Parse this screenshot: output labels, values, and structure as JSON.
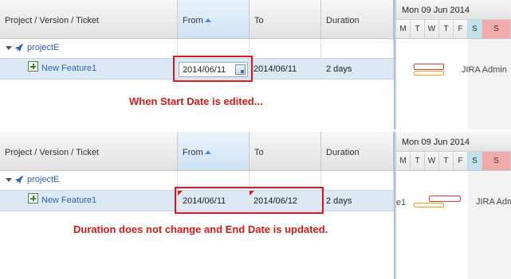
{
  "columns": {
    "project": "Project / Version / Ticket",
    "from": "From",
    "to": "To",
    "duration": "Duration"
  },
  "project_row": {
    "name": "projectE"
  },
  "before": {
    "ticket": "New Feature1",
    "from_value": "2014/06/11",
    "to_value": "2014/06/11",
    "duration_value": "2 days",
    "caption": "When Start Date is edited..."
  },
  "after": {
    "ticket": "New Feature1",
    "ticket_clipped": "e1",
    "from_value": "2014/06/11",
    "to_value": "2014/06/12",
    "duration_value": "2 days",
    "caption": "Duration does not change and End Date is updated."
  },
  "gantt": {
    "week_label": "Mon 09 Jun 2014",
    "days": [
      "M",
      "T",
      "W",
      "T",
      "F",
      "S",
      "S"
    ],
    "assignee": "JIRA Admin"
  },
  "colors": {
    "annotation_red": "#d21a1a",
    "link_blue": "#2b62b8",
    "selected_row": "#dde8f5",
    "saturday": "#bfe3ec",
    "sunday": "#f1aaaa"
  }
}
